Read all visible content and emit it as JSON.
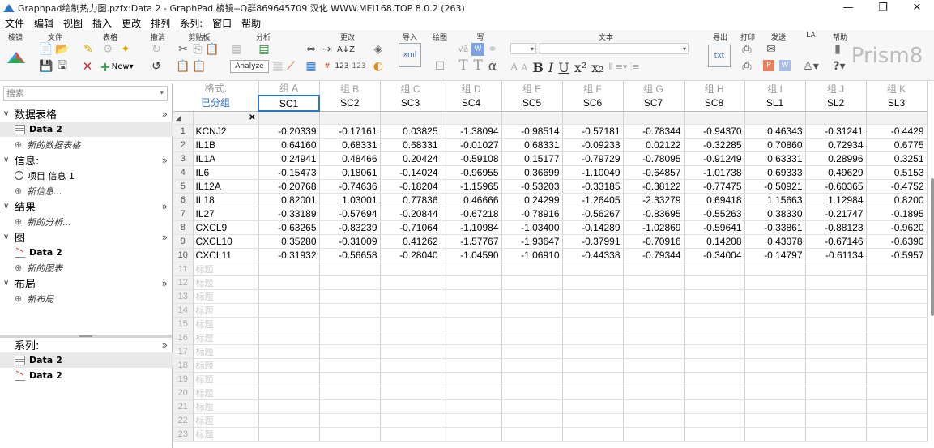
{
  "window": {
    "title": "Graphpad绘制热力图.pzfx:Data 2 - GraphPad 棱镜--Q群869645709 汉化 WWW.MEI168.TOP 8.0.2 (263)",
    "minimize": "—",
    "restore": "❐",
    "close": "✕"
  },
  "menu": [
    "文件",
    "编辑",
    "视图",
    "插入",
    "更改",
    "排列",
    "系列:",
    "窗口",
    "帮助"
  ],
  "ribbon": {
    "groups": [
      "棱镜",
      "文件",
      "表格",
      "撤消",
      "剪贴板",
      "分析",
      "更改",
      "导入",
      "绘图",
      "写",
      "文本",
      "导出",
      "打印",
      "发送",
      "LA",
      "帮助"
    ],
    "new_label": "New",
    "analyze_label": "Analyze",
    "brand": "Prism8",
    "brand_sub": "GraphPad"
  },
  "sidebar": {
    "search_placeholder": "搜索",
    "sections": [
      {
        "header": "数据表格",
        "items": [
          {
            "label": "Data 2",
            "icon": "table-icon",
            "selected": true
          }
        ],
        "new": "新的数据表格"
      },
      {
        "header": "信息:",
        "items": [
          {
            "label": "项目 信息 1",
            "icon": "info-icon",
            "selected": false
          }
        ],
        "new": "新信息..."
      },
      {
        "header": "结果",
        "items": [],
        "new": "新的分析..."
      },
      {
        "header": "图",
        "items": [
          {
            "label": "Data 2",
            "icon": "graph-icon",
            "selected": false
          }
        ],
        "new": "新的图表"
      },
      {
        "header": "布局",
        "items": [],
        "new": "新布局"
      }
    ],
    "family": {
      "header": "系列:",
      "items": [
        {
          "label": "Data 2",
          "icon": "table-icon"
        },
        {
          "label": "Data 2",
          "icon": "graph-icon"
        }
      ]
    }
  },
  "grid": {
    "format_label": "格式:",
    "format_value": "已分组",
    "groups": [
      "组 A",
      "组 B",
      "组 C",
      "组 D",
      "组 E",
      "组 F",
      "组 G",
      "组 H",
      "组 I",
      "组 J",
      "组 K"
    ],
    "columns": [
      "SC1",
      "SC2",
      "SC3",
      "SC4",
      "SC5",
      "SC6",
      "SC7",
      "SC8",
      "SL1",
      "SL2",
      "SL3"
    ],
    "placeholder_title": "标题",
    "rows": [
      {
        "n": "1",
        "title": "KCNJ2",
        "v": [
          "-0.20339",
          "-0.17161",
          "0.03825",
          "-1.38094",
          "-0.98514",
          "-0.57181",
          "-0.78344",
          "-0.94370",
          "0.46343",
          "-0.31241",
          "-0.4429"
        ]
      },
      {
        "n": "2",
        "title": "IL1B",
        "v": [
          "0.64160",
          "0.68331",
          "0.68331",
          "-0.01027",
          "0.68331",
          "-0.09233",
          "0.02122",
          "-0.32285",
          "0.70860",
          "0.72934",
          "0.6775"
        ]
      },
      {
        "n": "3",
        "title": "IL1A",
        "v": [
          "0.24941",
          "0.48466",
          "0.20424",
          "-0.59108",
          "0.15177",
          "-0.79729",
          "-0.78095",
          "-0.91249",
          "0.63331",
          "0.28996",
          "0.3251"
        ]
      },
      {
        "n": "4",
        "title": "IL6",
        "v": [
          "-0.15473",
          "0.18061",
          "-0.14024",
          "-0.96955",
          "0.36699",
          "-1.10049",
          "-0.64857",
          "-1.01738",
          "0.69333",
          "0.49629",
          "0.5153"
        ]
      },
      {
        "n": "5",
        "title": "IL12A",
        "v": [
          "-0.20768",
          "-0.74636",
          "-0.18204",
          "-1.15965",
          "-0.53203",
          "-0.33185",
          "-0.38122",
          "-0.77475",
          "-0.50921",
          "-0.60365",
          "-0.4752"
        ]
      },
      {
        "n": "6",
        "title": "IL18",
        "v": [
          "0.82001",
          "1.03001",
          "0.77836",
          "0.46666",
          "0.24299",
          "-1.26405",
          "-2.33279",
          "0.69418",
          "1.15663",
          "1.12984",
          "0.8200"
        ]
      },
      {
        "n": "7",
        "title": "IL27",
        "v": [
          "-0.33189",
          "-0.57694",
          "-0.20844",
          "-0.67218",
          "-0.78916",
          "-0.56267",
          "-0.83695",
          "-0.55263",
          "0.38330",
          "-0.21747",
          "-0.1895"
        ]
      },
      {
        "n": "8",
        "title": "CXCL9",
        "v": [
          "-0.63265",
          "-0.83239",
          "-0.71064",
          "-1.10984",
          "-1.03400",
          "-0.14289",
          "-1.02869",
          "-0.59641",
          "-0.33861",
          "-0.88123",
          "-0.9620"
        ]
      },
      {
        "n": "9",
        "title": "CXCL10",
        "v": [
          "0.35280",
          "-0.31009",
          "0.41262",
          "-1.57767",
          "-1.93647",
          "-0.37991",
          "-0.70916",
          "0.14208",
          "0.43078",
          "-0.67146",
          "-0.6390"
        ]
      },
      {
        "n": "10",
        "title": "CXCL11",
        "v": [
          "-0.31932",
          "-0.56658",
          "-0.28040",
          "-1.04590",
          "-1.06910",
          "-0.44338",
          "-0.79344",
          "-0.34004",
          "-0.14797",
          "-0.61134",
          "-0.5957"
        ]
      }
    ],
    "empty_row_numbers": [
      "11",
      "12",
      "13",
      "14",
      "15",
      "16",
      "17",
      "18",
      "19",
      "20",
      "21",
      "22",
      "23"
    ]
  },
  "colors": {
    "accent": "#2a74c9",
    "group_header": "#9a9a9a"
  }
}
